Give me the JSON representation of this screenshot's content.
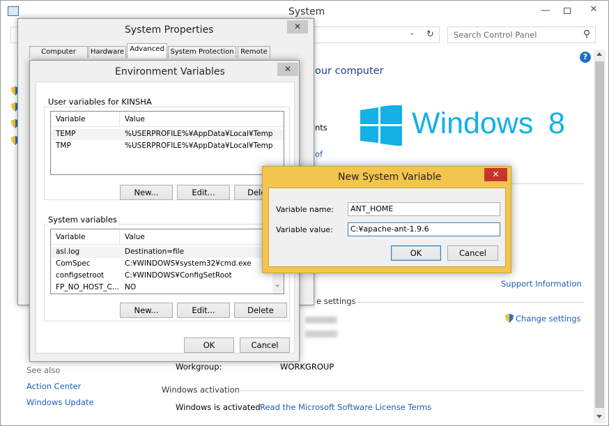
{
  "system_window": {
    "title": "System",
    "search_placeholder": "Search Control Panel",
    "heading_fragment": "our computer",
    "text_fragment_1": "nts",
    "link_fragment": "of",
    "windows_logo_text": "Windows",
    "windows_logo_version": "8",
    "support_link": "Support Information",
    "section_settings_fragment": "e settings",
    "change_settings": "Change settings",
    "see_also": "See also",
    "action_center": "Action Center",
    "windows_update": "Windows Update",
    "workgroup_label": "Workgroup:",
    "workgroup_value": "WORKGROUP",
    "activation_heading": "Windows activation",
    "activation_status": "Windows is activated",
    "license_link": "Read the Microsoft Software License Terms",
    "help_glyph": "?",
    "colors": {
      "link": "#1e5fb3",
      "logo": "#14b0e6"
    }
  },
  "system_properties": {
    "title": "System Properties",
    "tabs": [
      "Computer Name",
      "Hardware",
      "Advanced",
      "System Protection",
      "Remote"
    ],
    "active_tab": "Advanced"
  },
  "env_vars": {
    "title": "Environment Variables",
    "user_group_title": "User variables for KINSHA",
    "columns": [
      "Variable",
      "Value"
    ],
    "user_vars": [
      {
        "name": "TEMP",
        "value": "%USERPROFILE%¥AppData¥Local¥Temp"
      },
      {
        "name": "TMP",
        "value": "%USERPROFILE%¥AppData¥Local¥Temp"
      }
    ],
    "user_buttons": {
      "new": "New...",
      "edit": "Edit...",
      "delete": "Delete"
    },
    "system_group_title": "System variables",
    "system_vars": [
      {
        "name": "asl.log",
        "value": "Destination=file"
      },
      {
        "name": "ComSpec",
        "value": "C:¥WINDOWS¥system32¥cmd.exe"
      },
      {
        "name": "configsetroot",
        "value": "C:¥WINDOWS¥ConfigSetRoot"
      },
      {
        "name": "FP_NO_HOST_C...",
        "value": "NO"
      }
    ],
    "system_buttons": {
      "new": "New...",
      "edit": "Edit...",
      "delete": "Delete"
    },
    "ok": "OK",
    "cancel": "Cancel"
  },
  "new_var_dialog": {
    "title": "New System Variable",
    "name_label": "Variable name:",
    "value_label": "Variable value:",
    "name_value": "ANT_HOME",
    "value_value": "C:¥apache-ant-1.9.6",
    "ok": "OK",
    "cancel": "Cancel",
    "colors": {
      "frame": "#f3c54e",
      "close": "#c7362c"
    }
  }
}
